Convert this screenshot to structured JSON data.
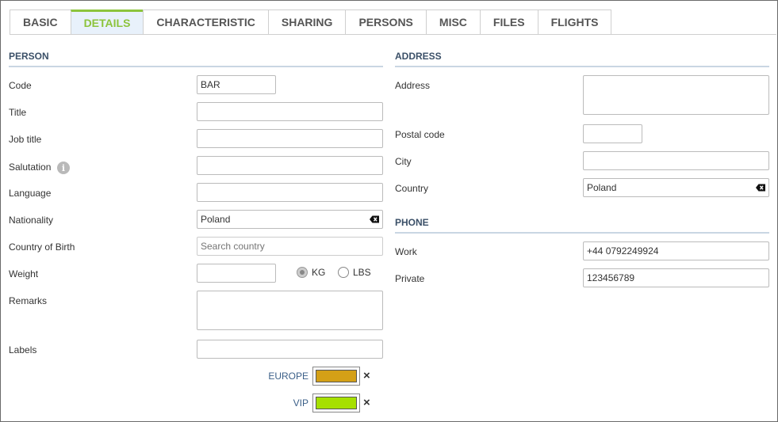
{
  "tabs": [
    {
      "label": "BASIC",
      "active": false
    },
    {
      "label": "DETAILS",
      "active": true
    },
    {
      "label": "CHARACTERISTIC",
      "active": false
    },
    {
      "label": "SHARING",
      "active": false
    },
    {
      "label": "PERSONS",
      "active": false
    },
    {
      "label": "MISC",
      "active": false
    },
    {
      "label": "FILES",
      "active": false
    },
    {
      "label": "FLIGHTS",
      "active": false
    }
  ],
  "person": {
    "section_title": "PERSON",
    "code_label": "Code",
    "code_value": "BAR",
    "title_label": "Title",
    "title_value": "",
    "job_title_label": "Job title",
    "job_title_value": "",
    "salutation_label": "Salutation",
    "salutation_value": "",
    "language_label": "Language",
    "language_value": "",
    "nationality_label": "Nationality",
    "nationality_value": "Poland",
    "country_of_birth_label": "Country of Birth",
    "country_of_birth_placeholder": "Search country",
    "weight_label": "Weight",
    "weight_value": "",
    "unit_kg": "KG",
    "unit_lbs": "LBS",
    "selected_unit": "KG",
    "remarks_label": "Remarks",
    "remarks_value": "",
    "labels_label": "Labels",
    "labels_value": "",
    "tags": [
      {
        "name": "EUROPE",
        "color": "#d4a017"
      },
      {
        "name": "VIP",
        "color": "#a6e000"
      }
    ]
  },
  "address": {
    "section_title": "ADDRESS",
    "address_label": "Address",
    "address_value": "",
    "postal_code_label": "Postal code",
    "postal_code_value": "",
    "city_label": "City",
    "city_value": "",
    "country_label": "Country",
    "country_value": "Poland"
  },
  "phone": {
    "section_title": "PHONE",
    "work_label": "Work",
    "work_value": "+44 0792249924",
    "private_label": "Private",
    "private_value": "123456789"
  },
  "colors": {
    "accent_green": "#8cc43c",
    "section_title": "#3b5068",
    "tag_text": "#3b5f88"
  },
  "icons": {
    "clear": "backspace-clear-icon",
    "info": "info-icon",
    "remove": "close-icon"
  }
}
